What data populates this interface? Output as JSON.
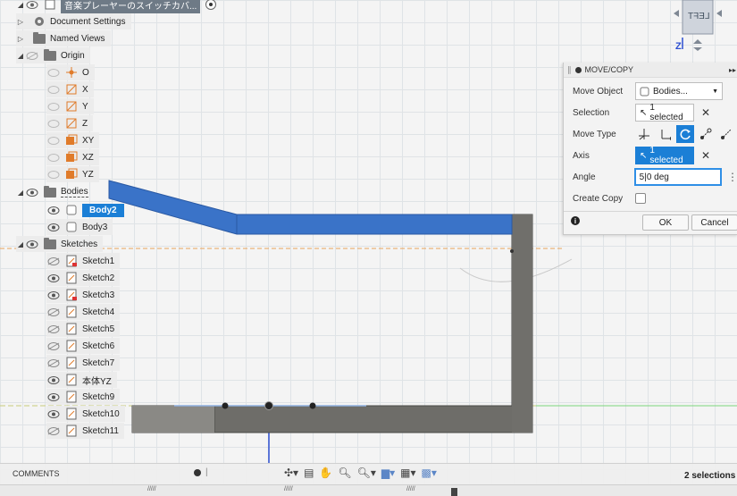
{
  "browser": {
    "doc_title": "音楽プレーヤーのスイッチカバ...",
    "items": {
      "document_settings": "Document Settings",
      "named_views": "Named Views",
      "origin": "Origin",
      "o": "O",
      "x": "X",
      "y": "Y",
      "z": "Z",
      "xy": "XY",
      "xz": "XZ",
      "yz": "YZ",
      "bodies": "Bodies",
      "body2": "Body2",
      "body3": "Body3",
      "sketches": "Sketches"
    },
    "sketches": [
      "Sketch1",
      "Sketch2",
      "Sketch3",
      "Sketch4",
      "Sketch5",
      "Sketch6",
      "Sketch7",
      "本体YZ",
      "Sketch9",
      "Sketch10",
      "Sketch11"
    ]
  },
  "viewcube": {
    "face": "LEFT",
    "axis": "Z"
  },
  "dialog": {
    "title": "MOVE/COPY",
    "move_object_label": "Move Object",
    "move_object_value": "Bodies...",
    "selection_label": "Selection",
    "selection_value": "1 selected",
    "move_type_label": "Move Type",
    "axis_label": "Axis",
    "axis_value": "1 selected",
    "angle_label": "Angle",
    "angle_value": "5|0 deg",
    "create_copy_label": "Create Copy",
    "ok": "OK",
    "cancel": "Cancel"
  },
  "bottom": {
    "comments": "COMMENTS",
    "status": "2 selections"
  },
  "colors": {
    "accent": "#1b7fd6",
    "body_blue": "#3a73c8",
    "body_gray": "#6e6d69",
    "origin_orange": "#e07b2a"
  }
}
